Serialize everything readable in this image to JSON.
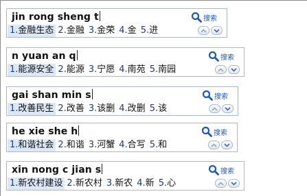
{
  "search_label": "搜索",
  "ime_boxes": [
    {
      "composition": "jin rong sheng t",
      "candidates": [
        {
          "num": "1.",
          "text": "金融生态"
        },
        {
          "num": "2.",
          "text": "金融"
        },
        {
          "num": "3.",
          "text": "金荣"
        },
        {
          "num": "4.",
          "text": "金"
        },
        {
          "num": "5.",
          "text": "进"
        }
      ]
    },
    {
      "composition": "n yuan an q",
      "candidates": [
        {
          "num": "1.",
          "text": "能源安全"
        },
        {
          "num": "2.",
          "text": "能源"
        },
        {
          "num": "3.",
          "text": "宁愿"
        },
        {
          "num": "4.",
          "text": "南苑"
        },
        {
          "num": "5.",
          "text": "南园"
        }
      ]
    },
    {
      "composition": "gai shan min s",
      "candidates": [
        {
          "num": "1.",
          "text": "改善民生"
        },
        {
          "num": "2.",
          "text": "改善"
        },
        {
          "num": "3.",
          "text": "该删"
        },
        {
          "num": "4.",
          "text": "改删"
        },
        {
          "num": "5.",
          "text": "该"
        }
      ]
    },
    {
      "composition": "he xie she h",
      "candidates": [
        {
          "num": "1.",
          "text": "和谐社会"
        },
        {
          "num": "2.",
          "text": "和谐"
        },
        {
          "num": "3.",
          "text": "河蟹"
        },
        {
          "num": "4.",
          "text": "合写"
        },
        {
          "num": "5.",
          "text": "和"
        }
      ]
    },
    {
      "composition": "xin nong c jian s",
      "candidates": [
        {
          "num": "1.",
          "text": "新农村建设"
        },
        {
          "num": "2.",
          "text": "新农村"
        },
        {
          "num": "3.",
          "text": "新农"
        },
        {
          "num": "4.",
          "text": "新"
        },
        {
          "num": "5.",
          "text": "心"
        }
      ]
    }
  ]
}
